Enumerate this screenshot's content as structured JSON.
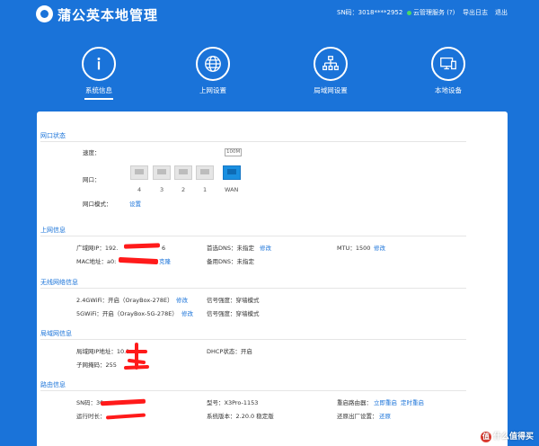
{
  "header": {
    "brand_title": "蒲公英本地管理",
    "sn_label": "SN码：3018****2952",
    "cloud_label": "云管理服务 (?)",
    "export_label": "导出日志",
    "logout_label": "退出"
  },
  "nav": {
    "items": [
      {
        "label": "系统信息",
        "icon": "info-icon",
        "active": true
      },
      {
        "label": "上网设置",
        "icon": "globe-icon",
        "active": false
      },
      {
        "label": "局域网设置",
        "icon": "network-tree-icon",
        "active": false
      },
      {
        "label": "本地设备",
        "icon": "monitor-icon",
        "active": false
      }
    ]
  },
  "port_status": {
    "title": "网口状态",
    "speed_label": "速度：",
    "speed_tag": "100M",
    "port_label": "网口：",
    "ports": [
      "4",
      "3",
      "2",
      "1",
      "WAN"
    ],
    "mode_label": "网口模式：",
    "mode_link": "设置"
  },
  "internet": {
    "title": "上网信息",
    "wan_ip_label": "广域网IP：192.",
    "wan_ip_suffix": "6",
    "mac_label": "MAC地址：a0:",
    "mac_link": "克隆",
    "dns1_label": "首选DNS：未指定",
    "dns1_link": "修改",
    "dns2_label": "备用DNS：未指定",
    "mtu_label": "MTU：1500",
    "mtu_link": "修改"
  },
  "wireless": {
    "title": "无线网络信息",
    "wifi24_label": "2.4GWiFi：开启（OrayBox-278E）",
    "wifi24_link": "修改",
    "wifi5_label": "5GWiFi：开启（OrayBox-5G-278E）",
    "wifi5_link": "修改",
    "strength1_label": "信号强度：穿墙模式",
    "strength2_label": "信号强度：穿墙模式"
  },
  "lan": {
    "title": "局域网信息",
    "lan_ip_label": "局域网IP地址：10.1",
    "mask_label": "子网掩码：255",
    "dhcp_label": "DHCP状态：开启"
  },
  "router": {
    "title": "路由信息",
    "sn_label": "SN码：30",
    "uptime_label": "运行时长：",
    "model_label": "型号：X3Pro-1153",
    "version_label": "系统版本：2.20.0 稳定版",
    "reboot_label": "重启路由器：",
    "reboot_now_link": "立即重启",
    "reboot_timer_link": "定时重启",
    "reset_label": "还原出厂设置：",
    "reset_link": "还原"
  },
  "watermark": {
    "badge": "值",
    "text": "什么值得买"
  },
  "colors": {
    "brand_blue": "#1a73d9",
    "redaction": "#ff1a1a",
    "cloud_status": "#4cd964"
  }
}
